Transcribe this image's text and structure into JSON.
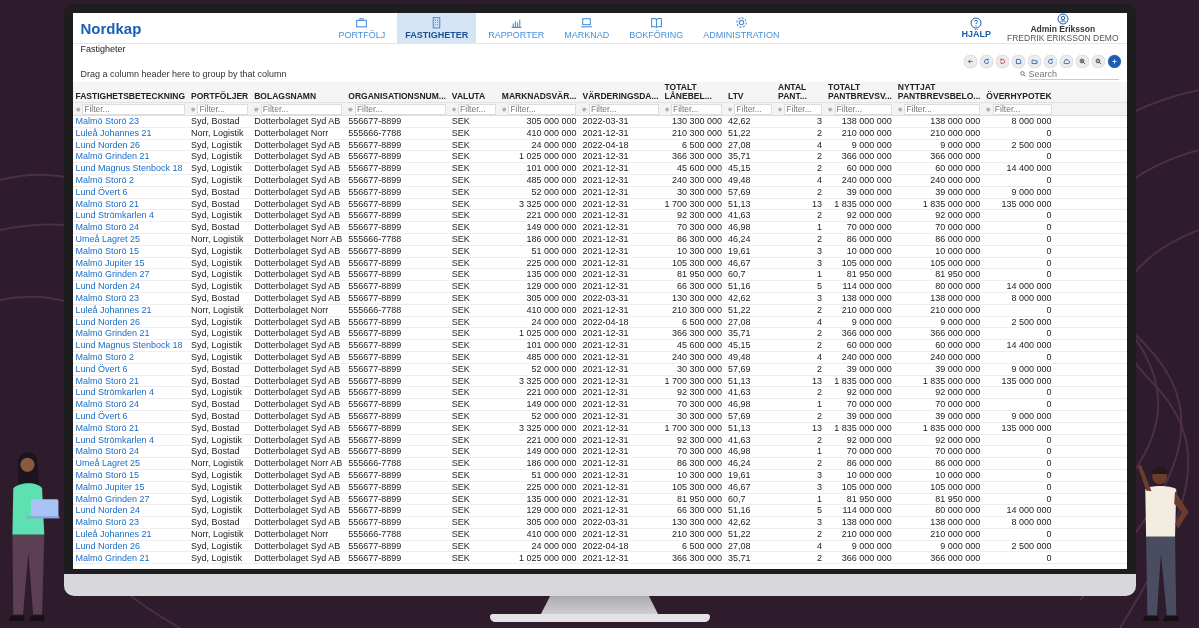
{
  "app": {
    "logo": "Nordkap",
    "nav": [
      {
        "label": "PORTFÖLJ",
        "selected": false
      },
      {
        "label": "FASTIGHETER",
        "selected": true
      },
      {
        "label": "RAPPORTER",
        "selected": false
      },
      {
        "label": "MARKNAD",
        "selected": false
      },
      {
        "label": "BOKFÖRING",
        "selected": false
      },
      {
        "label": "ADMINISTRATION",
        "selected": false
      }
    ],
    "help": "HJÄLP",
    "user": {
      "name": "Admin Eriksson",
      "company": "FREDRIK ERIKSSON DEMO"
    },
    "breadcrumb": "Fastigheter",
    "group_hint": "Drag a column header here to group by that column",
    "search": {
      "placeholder": "Search"
    },
    "table": {
      "columns": [
        {
          "label": "FASTIGHETSBETECKNING",
          "filter_placeholder": "Filter..."
        },
        {
          "label": "PORTFÖLJER",
          "filter_placeholder": "Filter..."
        },
        {
          "label": "BOLAGSNAMN",
          "filter_placeholder": "Filter..."
        },
        {
          "label": "ORGANISATIONSNUM...",
          "filter_placeholder": "Filter..."
        },
        {
          "label": "VALUTA",
          "filter_placeholder": "Filter..."
        },
        {
          "label": "MARKNADSVÄR...",
          "filter_placeholder": "Filter..."
        },
        {
          "label": "VÄRDERINGSDA...",
          "filter_placeholder": "Filter..."
        },
        {
          "label": "TOTALT LÅNEBEL...",
          "filter_placeholder": "Filter..."
        },
        {
          "label": "LTV",
          "filter_placeholder": "Filter..."
        },
        {
          "label": "ANTAL PANT...",
          "filter_placeholder": "Filter..."
        },
        {
          "label": "TOTALT PANTBREVSV...",
          "filter_placeholder": "Filter..."
        },
        {
          "label": "NYTTJAT PANTBREVSBELO...",
          "filter_placeholder": "Filter..."
        },
        {
          "label": "ÖVERHYPOTEK",
          "filter_placeholder": "Filter..."
        }
      ],
      "rows": [
        [
          "Malmö Storö 23",
          "Syd, Bostad",
          "Dotterbolaget Syd AB",
          "556677-8899",
          "SEK",
          "305 000 000",
          "2022-03-31",
          "130 300 000",
          "42,62",
          "3",
          "138 000 000",
          "138 000 000",
          "8 000 000"
        ],
        [
          "Luleå Johannes 21",
          "Norr, Logistik",
          "Dotterbolaget Norr",
          "555666-7788",
          "SEK",
          "410 000 000",
          "2021-12-31",
          "210 300 000",
          "51,22",
          "2",
          "210 000 000",
          "210 000 000",
          "0"
        ],
        [
          "Lund Norden 26",
          "Syd, Logistik",
          "Dotterbolaget Syd AB",
          "556677-8899",
          "SEK",
          "24 000 000",
          "2022-04-18",
          "6 500 000",
          "27,08",
          "4",
          "9 000 000",
          "9 000 000",
          "2 500 000"
        ],
        [
          "Malmö Grinden 21",
          "Syd, Logistik",
          "Dotterbolaget Syd AB",
          "556677-8899",
          "SEK",
          "1 025 000 000",
          "2021-12-31",
          "366 300 000",
          "35,71",
          "2",
          "366 000 000",
          "366 000 000",
          "0"
        ],
        [
          "Lund Magnus Stenbock 18",
          "Syd, Logistik",
          "Dotterbolaget Syd AB",
          "556677-8899",
          "SEK",
          "101 000 000",
          "2021-12-31",
          "45 600 000",
          "45,15",
          "2",
          "60 000 000",
          "60 000 000",
          "14 400 000"
        ],
        [
          "Malmö Storö 2",
          "Syd, Logistik",
          "Dotterbolaget Syd AB",
          "556677-8899",
          "SEK",
          "485 000 000",
          "2021-12-31",
          "240 300 000",
          "49,48",
          "4",
          "240 000 000",
          "240 000 000",
          "0"
        ],
        [
          "Lund Övert 6",
          "Syd, Bostad",
          "Dotterbolaget Syd AB",
          "556677-8899",
          "SEK",
          "52 000 000",
          "2021-12-31",
          "30 300 000",
          "57,69",
          "2",
          "39 000 000",
          "39 000 000",
          "9 000 000"
        ],
        [
          "Malmö Storö 21",
          "Syd, Bostad",
          "Dotterbolaget Syd AB",
          "556677-8899",
          "SEK",
          "3 325 000 000",
          "2021-12-31",
          "1 700 300 000",
          "51,13",
          "13",
          "1 835 000 000",
          "1 835 000 000",
          "135 000 000"
        ],
        [
          "Lund Strömkarlen 4",
          "Syd, Logistik",
          "Dotterbolaget Syd AB",
          "556677-8899",
          "SEK",
          "221 000 000",
          "2021-12-31",
          "92 300 000",
          "41,63",
          "2",
          "92 000 000",
          "92 000 000",
          "0"
        ],
        [
          "Malmö Storö 24",
          "Syd, Bostad",
          "Dotterbolaget Syd AB",
          "556677-8899",
          "SEK",
          "149 000 000",
          "2021-12-31",
          "70 300 000",
          "46,98",
          "1",
          "70 000 000",
          "70 000 000",
          "0"
        ],
        [
          "Umeå Lagret 25",
          "Norr, Logistik",
          "Dotterbolaget Norr AB",
          "555666-7788",
          "SEK",
          "186 000 000",
          "2021-12-31",
          "86 300 000",
          "46,24",
          "2",
          "86 000 000",
          "86 000 000",
          "0"
        ],
        [
          "Malmö Storö 15",
          "Syd, Logistik",
          "Dotterbolaget Syd AB",
          "556677-8899",
          "SEK",
          "51 000 000",
          "2021-12-31",
          "10 300 000",
          "19,61",
          "3",
          "10 000 000",
          "10 000 000",
          "0"
        ],
        [
          "Malmö Jupiter 15",
          "Syd, Logistik",
          "Dotterbolaget Syd AB",
          "556677-8899",
          "SEK",
          "225 000 000",
          "2021-12-31",
          "105 300 000",
          "46,67",
          "3",
          "105 000 000",
          "105 000 000",
          "0"
        ],
        [
          "Malmö Grinden 27",
          "Syd, Logistik",
          "Dotterbolaget Syd AB",
          "556677-8899",
          "SEK",
          "135 000 000",
          "2021-12-31",
          "81 950 000",
          "60,7",
          "1",
          "81 950 000",
          "81 950 000",
          "0"
        ],
        [
          "Lund Norden 24",
          "Syd, Logistik",
          "Dotterbolaget Syd AB",
          "556677-8899",
          "SEK",
          "129 000 000",
          "2021-12-31",
          "66 300 000",
          "51,16",
          "5",
          "114 000 000",
          "80 000 000",
          "14 000 000"
        ],
        [
          "Malmö Storö 23",
          "Syd, Bostad",
          "Dotterbolaget Syd AB",
          "556677-8899",
          "SEK",
          "305 000 000",
          "2022-03-31",
          "130 300 000",
          "42,62",
          "3",
          "138 000 000",
          "138 000 000",
          "8 000 000"
        ],
        [
          "Luleå Johannes 21",
          "Norr, Logistik",
          "Dotterbolaget Norr",
          "555666-7788",
          "SEK",
          "410 000 000",
          "2021-12-31",
          "210 300 000",
          "51,22",
          "2",
          "210 000 000",
          "210 000 000",
          "0"
        ],
        [
          "Lund Norden 26",
          "Syd, Logistik",
          "Dotterbolaget Syd AB",
          "556677-8899",
          "SEK",
          "24 000 000",
          "2022-04-18",
          "6 500 000",
          "27,08",
          "4",
          "9 000 000",
          "9 000 000",
          "2 500 000"
        ],
        [
          "Malmö Grinden 21",
          "Syd, Logistik",
          "Dotterbolaget Syd AB",
          "556677-8899",
          "SEK",
          "1 025 000 000",
          "2021-12-31",
          "366 300 000",
          "35,71",
          "2",
          "366 000 000",
          "366 000 000",
          "0"
        ],
        [
          "Lund Magnus Stenbock 18",
          "Syd, Logistik",
          "Dotterbolaget Syd AB",
          "556677-8899",
          "SEK",
          "101 000 000",
          "2021-12-31",
          "45 600 000",
          "45,15",
          "2",
          "60 000 000",
          "60 000 000",
          "14 400 000"
        ],
        [
          "Malmö Storö 2",
          "Syd, Logistik",
          "Dotterbolaget Syd AB",
          "556677-8899",
          "SEK",
          "485 000 000",
          "2021-12-31",
          "240 300 000",
          "49,48",
          "4",
          "240 000 000",
          "240 000 000",
          "0"
        ],
        [
          "Lund Övert 6",
          "Syd, Bostad",
          "Dotterbolaget Syd AB",
          "556677-8899",
          "SEK",
          "52 000 000",
          "2021-12-31",
          "30 300 000",
          "57,69",
          "2",
          "39 000 000",
          "39 000 000",
          "9 000 000"
        ],
        [
          "Malmö Storö 21",
          "Syd, Bostad",
          "Dotterbolaget Syd AB",
          "556677-8899",
          "SEK",
          "3 325 000 000",
          "2021-12-31",
          "1 700 300 000",
          "51,13",
          "13",
          "1 835 000 000",
          "1 835 000 000",
          "135 000 000"
        ],
        [
          "Lund Strömkarlen 4",
          "Syd, Logistik",
          "Dotterbolaget Syd AB",
          "556677-8899",
          "SEK",
          "221 000 000",
          "2021-12-31",
          "92 300 000",
          "41,63",
          "2",
          "92 000 000",
          "92 000 000",
          "0"
        ],
        [
          "Malmö Storö 24",
          "Syd, Bostad",
          "Dotterbolaget Syd AB",
          "556677-8899",
          "SEK",
          "149 000 000",
          "2021-12-31",
          "70 300 000",
          "46,98",
          "1",
          "70 000 000",
          "70 000 000",
          "0"
        ],
        [
          "Lund Övert 6",
          "Syd, Bostad",
          "Dotterbolaget Syd AB",
          "556677-8899",
          "SEK",
          "52 000 000",
          "2021-12-31",
          "30 300 000",
          "57,69",
          "2",
          "39 000 000",
          "39 000 000",
          "9 000 000"
        ],
        [
          "Malmö Storö 21",
          "Syd, Bostad",
          "Dotterbolaget Syd AB",
          "556677-8899",
          "SEK",
          "3 325 000 000",
          "2021-12-31",
          "1 700 300 000",
          "51,13",
          "13",
          "1 835 000 000",
          "1 835 000 000",
          "135 000 000"
        ],
        [
          "Lund Strömkarlen 4",
          "Syd, Logistik",
          "Dotterbolaget Syd AB",
          "556677-8899",
          "SEK",
          "221 000 000",
          "2021-12-31",
          "92 300 000",
          "41,63",
          "2",
          "92 000 000",
          "92 000 000",
          "0"
        ],
        [
          "Malmö Storö 24",
          "Syd, Bostad",
          "Dotterbolaget Syd AB",
          "556677-8899",
          "SEK",
          "149 000 000",
          "2021-12-31",
          "70 300 000",
          "46,98",
          "1",
          "70 000 000",
          "70 000 000",
          "0"
        ],
        [
          "Umeå Lagret 25",
          "Norr, Logistik",
          "Dotterbolaget Norr AB",
          "555666-7788",
          "SEK",
          "186 000 000",
          "2021-12-31",
          "86 300 000",
          "46,24",
          "2",
          "86 000 000",
          "86 000 000",
          "0"
        ],
        [
          "Malmö Storö 15",
          "Syd, Logistik",
          "Dotterbolaget Syd AB",
          "556677-8899",
          "SEK",
          "51 000 000",
          "2021-12-31",
          "10 300 000",
          "19,61",
          "3",
          "10 000 000",
          "10 000 000",
          "0"
        ],
        [
          "Malmö Jupiter 15",
          "Syd, Logistik",
          "Dotterbolaget Syd AB",
          "556677-8899",
          "SEK",
          "225 000 000",
          "2021-12-31",
          "105 300 000",
          "46,67",
          "3",
          "105 000 000",
          "105 000 000",
          "0"
        ],
        [
          "Malmö Grinden 27",
          "Syd, Logistik",
          "Dotterbolaget Syd AB",
          "556677-8899",
          "SEK",
          "135 000 000",
          "2021-12-31",
          "81 950 000",
          "60,7",
          "1",
          "81 950 000",
          "81 950 000",
          "0"
        ],
        [
          "Lund Norden 24",
          "Syd, Logistik",
          "Dotterbolaget Syd AB",
          "556677-8899",
          "SEK",
          "129 000 000",
          "2021-12-31",
          "66 300 000",
          "51,16",
          "5",
          "114 000 000",
          "80 000 000",
          "14 000 000"
        ],
        [
          "Malmö Storö 23",
          "Syd, Bostad",
          "Dotterbolaget Syd AB",
          "556677-8899",
          "SEK",
          "305 000 000",
          "2022-03-31",
          "130 300 000",
          "42,62",
          "3",
          "138 000 000",
          "138 000 000",
          "8 000 000"
        ],
        [
          "Luleå Johannes 21",
          "Norr, Logistik",
          "Dotterbolaget Norr",
          "555666-7788",
          "SEK",
          "410 000 000",
          "2021-12-31",
          "210 300 000",
          "51,22",
          "2",
          "210 000 000",
          "210 000 000",
          "0"
        ],
        [
          "Lund Norden 26",
          "Syd, Logistik",
          "Dotterbolaget Syd AB",
          "556677-8899",
          "SEK",
          "24 000 000",
          "2022-04-18",
          "6 500 000",
          "27,08",
          "4",
          "9 000 000",
          "9 000 000",
          "2 500 000"
        ],
        [
          "Malmö Grinden 21",
          "Syd, Logistik",
          "Dotterbolaget Syd AB",
          "556677-8899",
          "SEK",
          "1 025 000 000",
          "2021-12-31",
          "366 300 000",
          "35,71",
          "2",
          "366 000 000",
          "366 000 000",
          "0"
        ]
      ]
    }
  }
}
